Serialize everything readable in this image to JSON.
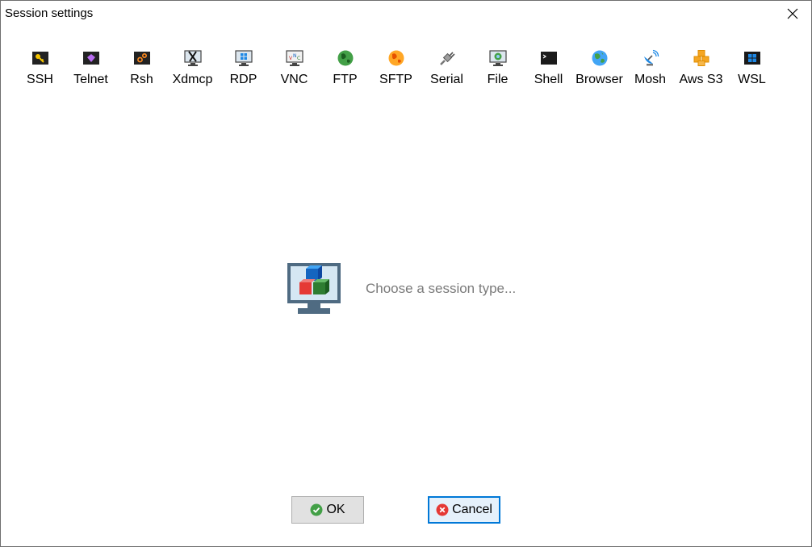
{
  "window": {
    "title": "Session settings"
  },
  "toolbar": {
    "items": [
      {
        "label": "SSH",
        "icon": "key-icon"
      },
      {
        "label": "Telnet",
        "icon": "telnet-icon"
      },
      {
        "label": "Rsh",
        "icon": "gears-icon"
      },
      {
        "label": "Xdmcp",
        "icon": "x-monitor-icon"
      },
      {
        "label": "RDP",
        "icon": "windows-monitor-icon"
      },
      {
        "label": "VNC",
        "icon": "vnc-monitor-icon"
      },
      {
        "label": "FTP",
        "icon": "green-globe-icon"
      },
      {
        "label": "SFTP",
        "icon": "orange-globe-icon"
      },
      {
        "label": "Serial",
        "icon": "serial-plug-icon"
      },
      {
        "label": "File",
        "icon": "file-monitor-icon"
      },
      {
        "label": "Shell",
        "icon": "terminal-icon"
      },
      {
        "label": "Browser",
        "icon": "globe-icon"
      },
      {
        "label": "Mosh",
        "icon": "satellite-dish-icon"
      },
      {
        "label": "Aws S3",
        "icon": "aws-cubes-icon"
      },
      {
        "label": "WSL",
        "icon": "wsl-windows-icon"
      }
    ]
  },
  "main": {
    "message": "Choose a session type..."
  },
  "buttons": {
    "ok": "OK",
    "cancel": "Cancel"
  }
}
